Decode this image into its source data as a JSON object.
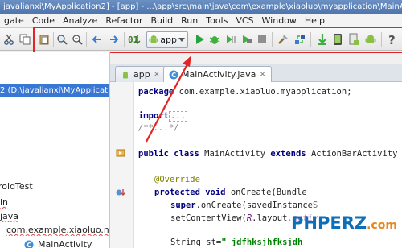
{
  "window": {
    "title": "javalianxi\\MyApplication2] - [app] - ...\\app\\src\\main\\java\\com\\example\\xiaoluo\\myapplication\\MainActivity"
  },
  "menu": [
    {
      "label": "gate"
    },
    {
      "label": "Code"
    },
    {
      "label": "Analyze"
    },
    {
      "label": "Refactor"
    },
    {
      "label": "Build"
    },
    {
      "label": "Run"
    },
    {
      "label": "Tools"
    },
    {
      "label": "VCS"
    },
    {
      "label": "Window"
    },
    {
      "label": "Help"
    }
  ],
  "toolbar": {
    "run_config": "app",
    "icons": [
      "cut-icon",
      "copy-icon",
      "paste-icon",
      "find-icon",
      "replace-icon",
      "back-icon",
      "forward-icon",
      "make-icon",
      "run-config-icon",
      "run-icon",
      "debug-icon",
      "attach-debugger-icon",
      "coverage-icon",
      "stop-icon",
      "project-structure-icon",
      "sdk-manager-icon",
      "gradle-sync-icon",
      "avd-manager-icon",
      "sdk-icon",
      "android-monitor-icon",
      "help-icon"
    ]
  },
  "project": {
    "root_label": "2 (D:\\javalianxi\\MyApplicatio",
    "items": [
      {
        "label": "roidTest"
      },
      {
        "label": "in"
      },
      {
        "label": "java"
      },
      {
        "label": "com.example.xiaoluo.mya"
      },
      {
        "label": "MainActivity"
      }
    ]
  },
  "tabs": [
    {
      "label": "app",
      "active": false
    },
    {
      "label": "MainActivity.java",
      "active": true
    }
  ],
  "code": {
    "l1_kw": "package",
    "l1_rest": " com.example.xiaoluo.myapplication;",
    "l2_kw": "import",
    "l2_rest": " ...",
    "l3": "/**...*/",
    "l4_kw1": "public class",
    "l4_name": " MainActivity ",
    "l4_kw2": "extends",
    "l4_rest": " ActionBarActivity {",
    "l5": "@Override",
    "l6_kw": "protected void",
    "l6_rest": " onCreate(Bundle",
    "l7_kw": "super",
    "l7_rest": ".onCreate(savedInstanceS",
    "l8_a": "setContentView(",
    "l8_b": "R",
    "l8_c": ".layout.",
    "l8_d": "activ",
    "l9_a": "String st=",
    "l9_b": "\" jdfhksjhfksjdh"
  },
  "watermark": {
    "brand": "PHPERZ",
    "tld": ".com"
  },
  "colors": {
    "highlight_frame": "#e22424",
    "selection": "#3877d4"
  }
}
